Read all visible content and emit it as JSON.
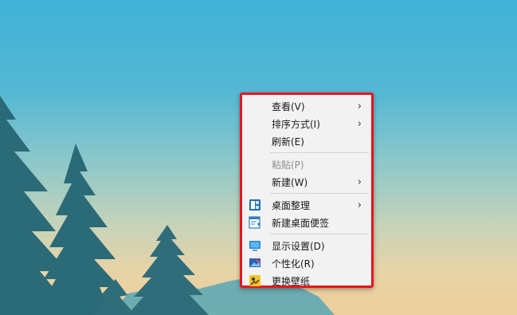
{
  "context_menu": {
    "items": [
      {
        "label": "查看(V)",
        "submenu_arrow": "›",
        "icon": null,
        "disabled": false
      },
      {
        "label": "排序方式(I)",
        "submenu_arrow": "›",
        "icon": null,
        "disabled": false
      },
      {
        "label": "刷新(E)",
        "submenu_arrow": null,
        "icon": null,
        "disabled": false
      },
      {
        "label": "粘贴(P)",
        "submenu_arrow": null,
        "icon": null,
        "disabled": true
      },
      {
        "label": "新建(W)",
        "submenu_arrow": "›",
        "icon": null,
        "disabled": false
      },
      {
        "label": "桌面整理",
        "submenu_arrow": "›",
        "icon": "desktop-organize-icon",
        "disabled": false
      },
      {
        "label": "新建桌面便签",
        "submenu_arrow": null,
        "icon": "desktop-note-icon",
        "disabled": false
      },
      {
        "label": "显示设置(D)",
        "submenu_arrow": null,
        "icon": "display-settings-icon",
        "disabled": false
      },
      {
        "label": "个性化(R)",
        "submenu_arrow": null,
        "icon": "personalize-icon",
        "disabled": false
      },
      {
        "label": "更换壁纸",
        "submenu_arrow": null,
        "icon": "change-wallpaper-icon",
        "disabled": false
      }
    ]
  },
  "colors": {
    "highlight_border": "#e8141c",
    "menu_background": "#f2f2f2",
    "tree": "#2d6b78",
    "hill": "#5aa7b0"
  }
}
